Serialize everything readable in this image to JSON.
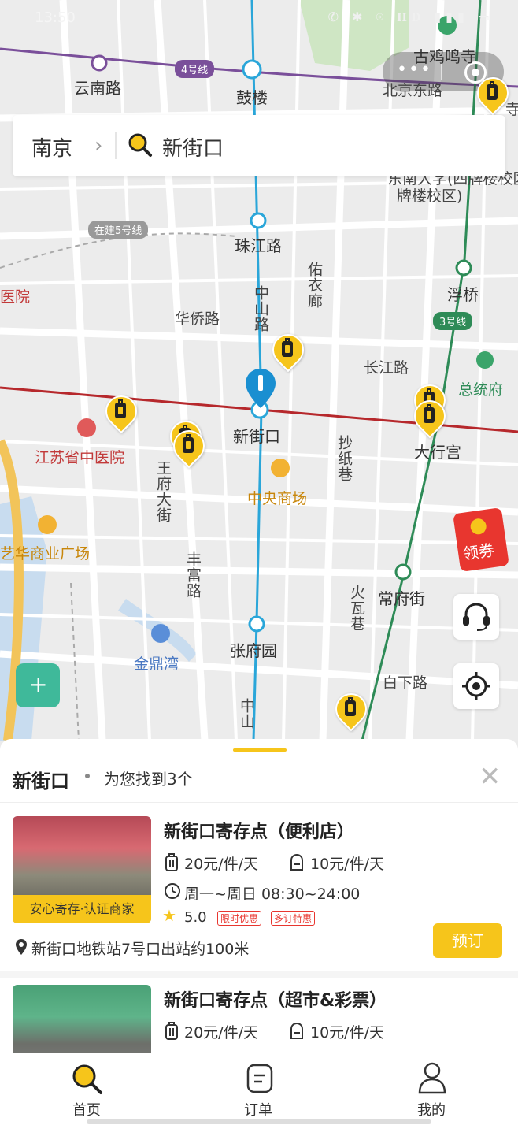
{
  "status": {
    "time": "13:50",
    "icons": "✆ ✱ ⌾ 𝐇𝐃 ▮▮▮ ▭"
  },
  "map": {
    "labels": [
      {
        "text": "云南路"
      },
      {
        "text": "鼓楼"
      },
      {
        "text": "古鸡鸣寺"
      },
      {
        "text": "北京东路"
      },
      {
        "text": "寺"
      },
      {
        "text": "珠江路"
      },
      {
        "text": "佑衣廊"
      },
      {
        "text": "浮桥"
      },
      {
        "text": "医院"
      },
      {
        "text": "华侨路"
      },
      {
        "text": "中山路"
      },
      {
        "text": "长江路"
      },
      {
        "text": "总统府"
      },
      {
        "text": "新街口"
      },
      {
        "text": "大行宫"
      },
      {
        "text": "江苏省中医院"
      },
      {
        "text": "王府大街"
      },
      {
        "text": "抄纸巷"
      },
      {
        "text": "中央商场"
      },
      {
        "text": "艺华商业广场"
      },
      {
        "text": "常府街"
      },
      {
        "text": "丰富路"
      },
      {
        "text": "火瓦巷"
      },
      {
        "text": "金鼎湾"
      },
      {
        "text": "张府园"
      },
      {
        "text": "白下路"
      },
      {
        "text": "中山"
      },
      {
        "text": "东南大学(四牌楼校区)"
      },
      {
        "text": "牌楼校区)"
      }
    ],
    "line_badges": {
      "line4": "4号线",
      "line5": "在建5号线",
      "line3": "3号线"
    }
  },
  "search": {
    "city": "南京",
    "query": "新街口"
  },
  "coupon": {
    "label": "领券"
  },
  "results": {
    "title": "新街口",
    "count_text": "为您找到3个",
    "items": [
      {
        "name": "新街口寄存点（便利店）",
        "price_luggage": "20元/件/天",
        "price_bag": "10元/件/天",
        "hours": "周一~周日 08:30~24:00",
        "rating": "5.0",
        "tags": [
          "限时优惠",
          "多订特惠"
        ],
        "badge": "安心寄存·认证商家",
        "address": "新街口地铁站7号口出站约100米",
        "book": "预订"
      },
      {
        "name": "新街口寄存点（超市&彩票）",
        "price_luggage": "20元/件/天",
        "price_bag": "10元/件/天"
      }
    ]
  },
  "tabs": [
    {
      "label": "首页"
    },
    {
      "label": "订单"
    },
    {
      "label": "我的"
    }
  ],
  "colors": {
    "accent": "#f6c51b",
    "red_line": "#b6282c",
    "metro_blue": "#2aa6d9",
    "metro_green": "#2e8b57",
    "line4_purple": "#7a4f9a"
  }
}
